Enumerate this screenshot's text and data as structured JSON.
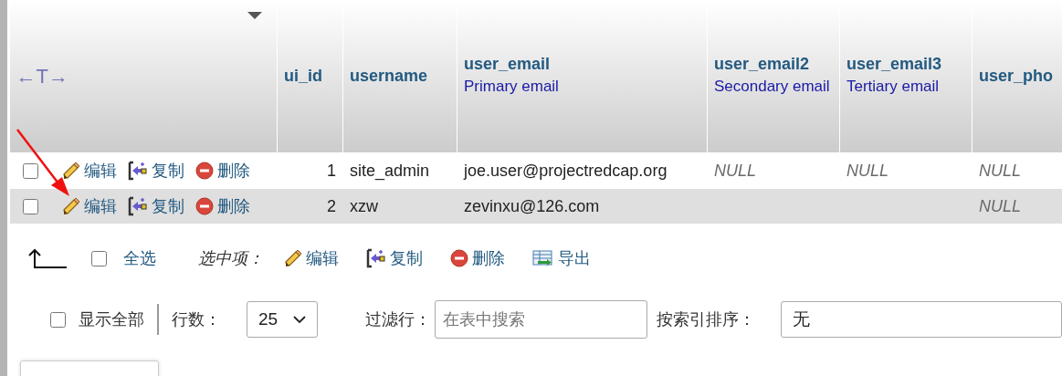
{
  "table": {
    "sort_toggle": "←T→",
    "columns": [
      {
        "name": "ui_id"
      },
      {
        "name": "username"
      },
      {
        "name": "user_email",
        "comment": "Primary email"
      },
      {
        "name": "user_email2",
        "comment": "Secondary email"
      },
      {
        "name": "user_email3",
        "comment": "Tertiary email"
      },
      {
        "name": "user_pho"
      }
    ],
    "rows": [
      {
        "checked": false,
        "actions": [
          {
            "kind": "edit",
            "label": "编辑"
          },
          {
            "kind": "copy",
            "label": "复制"
          },
          {
            "kind": "delete",
            "label": "删除"
          }
        ],
        "cells": [
          {
            "kind": "number",
            "value": "1"
          },
          {
            "kind": "text",
            "value": "site_admin"
          },
          {
            "kind": "text",
            "value": "joe.user@projectredcap.org"
          },
          {
            "kind": "null",
            "value": "NULL"
          },
          {
            "kind": "null",
            "value": "NULL"
          },
          {
            "kind": "null",
            "value": "NULL"
          }
        ]
      },
      {
        "checked": false,
        "actions": [
          {
            "kind": "edit",
            "label": "编辑"
          },
          {
            "kind": "copy",
            "label": "复制"
          },
          {
            "kind": "delete",
            "label": "删除"
          }
        ],
        "cells": [
          {
            "kind": "number",
            "value": "2"
          },
          {
            "kind": "text",
            "value": "xzw"
          },
          {
            "kind": "text",
            "value": "zevinxu@126.com"
          },
          null,
          null,
          {
            "kind": "null",
            "value": "NULL"
          }
        ]
      }
    ]
  },
  "bulk_actions": {
    "select_all": {
      "label": "全选",
      "checked": false
    },
    "with_selected": "选中项：",
    "actions": [
      {
        "kind": "edit",
        "label": "编辑"
      },
      {
        "kind": "copy",
        "label": "复制"
      },
      {
        "kind": "delete",
        "label": "删除"
      },
      {
        "kind": "export",
        "label": "导出"
      }
    ]
  },
  "navigation": {
    "show_all": {
      "label": "显示全部",
      "checked": false
    },
    "rows_label": "行数：",
    "rows_value": "25",
    "filter_label": "过滤行：",
    "filter_placeholder": "在表中搜索",
    "sort_label": "按索引排序：",
    "sort_value": "无"
  }
}
